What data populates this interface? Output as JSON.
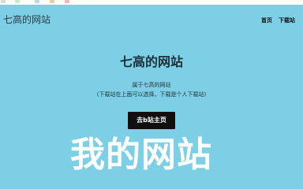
{
  "navbar": {
    "brand": "七高的网站",
    "links": [
      "首页",
      "下载站"
    ]
  },
  "hero": {
    "title": "七高的网站",
    "subtitle_line1": "属于七高的网站",
    "subtitle_line2": "(下载站在上面可以选择，下载是个人下载站)",
    "button_label": "去b站主页"
  },
  "overlay": {
    "text": "我的网站"
  },
  "colors": {
    "background": "#7ccfe4",
    "button_bg": "#0f0f10",
    "button_text": "#ffffff",
    "overlay_text": "#ffffff"
  }
}
